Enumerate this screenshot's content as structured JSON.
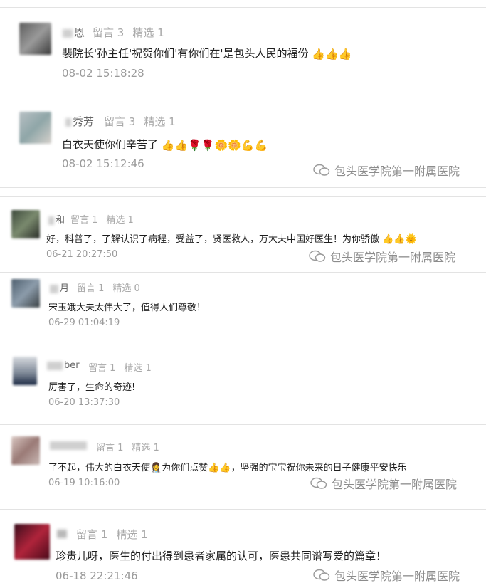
{
  "comments": [
    {
      "nick": "恩",
      "likes": "留言 3",
      "picks": "精选 1",
      "text": "裴院长'孙主任'祝贺你们'有你们在'是包头人民的福份",
      "emoji": [
        "thumbs-up",
        "thumbs-up",
        "thumbs-up"
      ],
      "time": "08-02 15:18:28",
      "watermark": ""
    },
    {
      "nick": "秀芳",
      "likes": "留言 3",
      "picks": "精选 1",
      "text": "白衣天使你们辛苦了",
      "emoji": [
        "thumbs-up",
        "thumbs-up",
        "rose",
        "rose",
        "flower",
        "flower",
        "muscle",
        "muscle"
      ],
      "time": "08-02 15:12:46",
      "watermark": "包头医学院第一附属医院"
    },
    {
      "nick": "和",
      "likes": "留言 1",
      "picks": "精选 1",
      "text": "好，科普了，了解认识了病程，受益了，贤医救人，万大夫中国好医生！为你骄傲",
      "emoji": [
        "thumbs-up",
        "thumbs-up",
        "sun"
      ],
      "time": "06-21 20:27:50",
      "watermark": "包头医学院第一附属医院"
    },
    {
      "nick": "月",
      "likes": "留言 1",
      "picks": "精选 0",
      "text": "宋玉娥大夫太伟大了，值得人们尊敬！",
      "emoji": [],
      "time": "06-29 01:04:19",
      "watermark": ""
    },
    {
      "nick": "ber",
      "likes": "留言 1",
      "picks": "精选 1",
      "text": "厉害了，生命的奇迹!",
      "emoji": [],
      "time": "06-20 13:37:30",
      "watermark": ""
    },
    {
      "nick": "",
      "likes": "留言 1",
      "picks": "精选 1",
      "text": "了不起，伟大的白衣天使",
      "text2": "为你们点赞",
      "text3": "，坚强的宝宝祝你未来的日子健康平安快乐",
      "emoji": [
        "nurse"
      ],
      "emoji2": [
        "thumbs-up",
        "thumbs-up"
      ],
      "time": "06-19 10:16:00",
      "watermark": "包头医学院第一附属医院"
    },
    {
      "nick": "",
      "likes": "留言 1",
      "picks": "精选 1",
      "text": "珍贵儿呀，医生的付出得到患者家属的认可，医患共同谱写爱的篇章！",
      "emoji": [],
      "time": "06-18 22:21:46",
      "watermark": "包头医学院第一附属医院"
    }
  ],
  "colors": {
    "background": "#ffffff",
    "meta": "#a8a8a8",
    "text": "#1e1e1e",
    "watermark": "#8c8c8c"
  }
}
